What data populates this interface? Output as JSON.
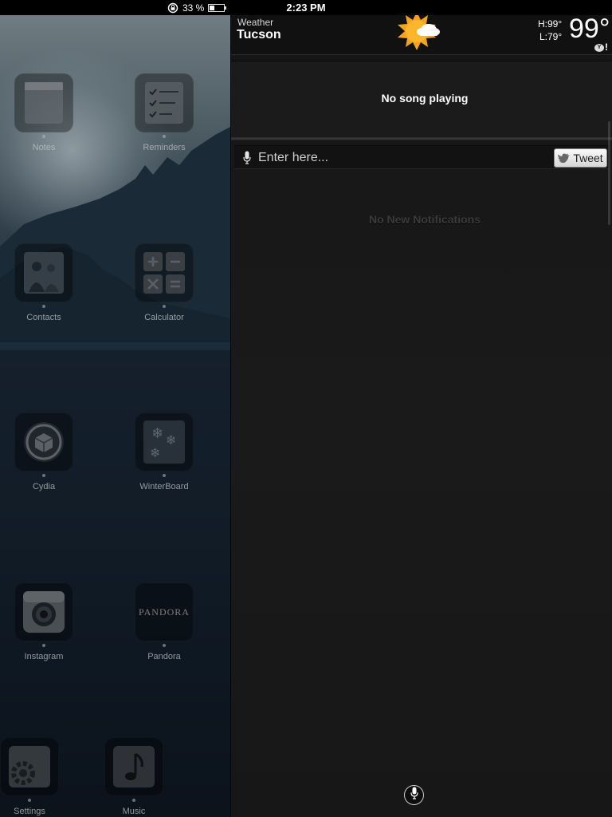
{
  "status_bar": {
    "time": "2:23 PM",
    "battery_text": "33 %",
    "battery_level": 0.33
  },
  "springboard": {
    "apps": [
      {
        "label": "Notes",
        "icon": "notes-icon"
      },
      {
        "label": "Reminders",
        "icon": "reminders-icon"
      },
      {
        "label": "Contacts",
        "icon": "contacts-icon"
      },
      {
        "label": "Calculator",
        "icon": "calculator-icon"
      },
      {
        "label": "Cydia",
        "icon": "cydia-icon"
      },
      {
        "label": "WinterBoard",
        "icon": "winterboard-icon"
      },
      {
        "label": "Instagram",
        "icon": "instagram-icon"
      },
      {
        "label": "Pandora",
        "icon": "pandora-icon",
        "logo_text": "PANDORA"
      },
      {
        "label": "Settings",
        "icon": "settings-icon"
      },
      {
        "label": "Music",
        "icon": "music-icon"
      }
    ]
  },
  "notification_center": {
    "weather": {
      "label": "Weather",
      "city": "Tucson",
      "high": "H:99°",
      "low": "L:79°",
      "temp": "99°",
      "condition_icon": "sun-cloud-icon",
      "provider_icon": "yahoo-icon",
      "provider_bang": "!"
    },
    "music": {
      "status": "No song playing"
    },
    "tweet": {
      "placeholder": "Enter here...",
      "button_label": "Tweet"
    },
    "notifications": {
      "empty_text": "No New Notifications"
    }
  },
  "colors": {
    "nc_background": "#1a1a1a",
    "sun": "#f7a21b"
  }
}
